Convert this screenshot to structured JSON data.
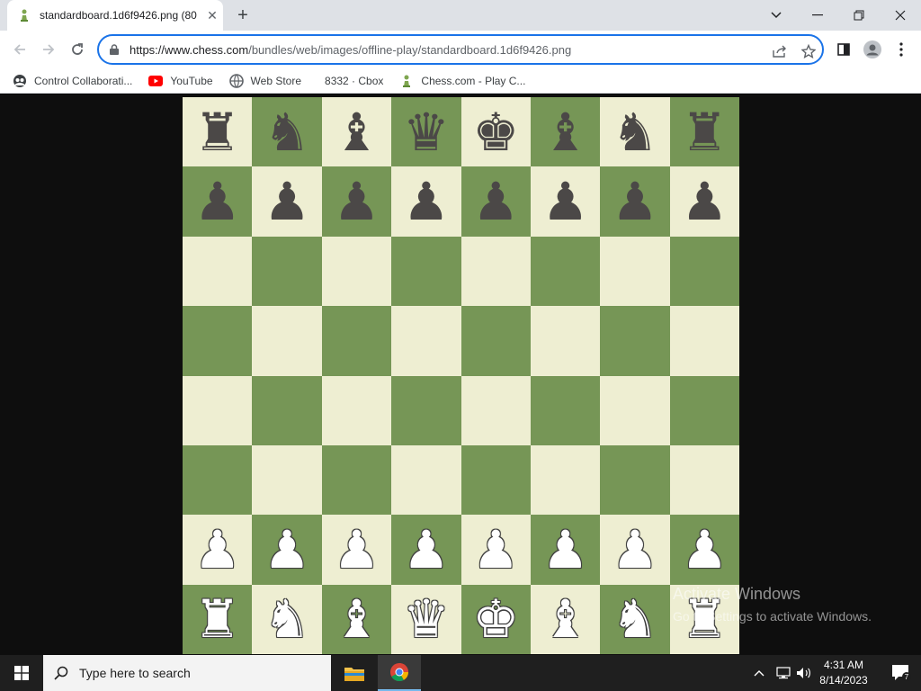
{
  "browser": {
    "tab_title": "standardboard.1d6f9426.png (80",
    "url_host": "https://www.chess.com",
    "url_path": "/bundles/web/images/offline-play/standardboard.1d6f9426.png",
    "bookmarks": [
      {
        "label": "Control Collaborati...",
        "icon": "globe-people-icon"
      },
      {
        "label": "YouTube",
        "icon": "youtube-icon"
      },
      {
        "label": "Web Store",
        "icon": "web-store-icon"
      },
      {
        "label": "8332 · Cbox",
        "icon": "none"
      },
      {
        "label": "Chess.com - Play C...",
        "icon": "chess-pawn-icon"
      }
    ]
  },
  "board": {
    "rows": [
      [
        "♜",
        "♞",
        "♝",
        "♛",
        "♚",
        "♝",
        "♞",
        "♜"
      ],
      [
        "♟",
        "♟",
        "♟",
        "♟",
        "♟",
        "♟",
        "♟",
        "♟"
      ],
      [
        "",
        "",
        "",
        "",
        "",
        "",
        "",
        ""
      ],
      [
        "",
        "",
        "",
        "",
        "",
        "",
        "",
        ""
      ],
      [
        "",
        "",
        "",
        "",
        "",
        "",
        "",
        ""
      ],
      [
        "",
        "",
        "",
        "",
        "",
        "",
        "",
        ""
      ],
      [
        "♟",
        "♟",
        "♟",
        "♟",
        "♟",
        "♟",
        "♟",
        "♟"
      ],
      [
        "♜",
        "♞",
        "♝",
        "♛",
        "♚",
        "♝",
        "♞",
        "♜"
      ]
    ],
    "light_color": "#eeeed2",
    "dark_color": "#769656"
  },
  "watermark": {
    "line1": "Activate Windows",
    "line2": "Go to Settings to activate Windows."
  },
  "taskbar": {
    "search_placeholder": "Type here to search",
    "time": "4:31 AM",
    "date": "8/14/2023",
    "notification_count": "7"
  }
}
